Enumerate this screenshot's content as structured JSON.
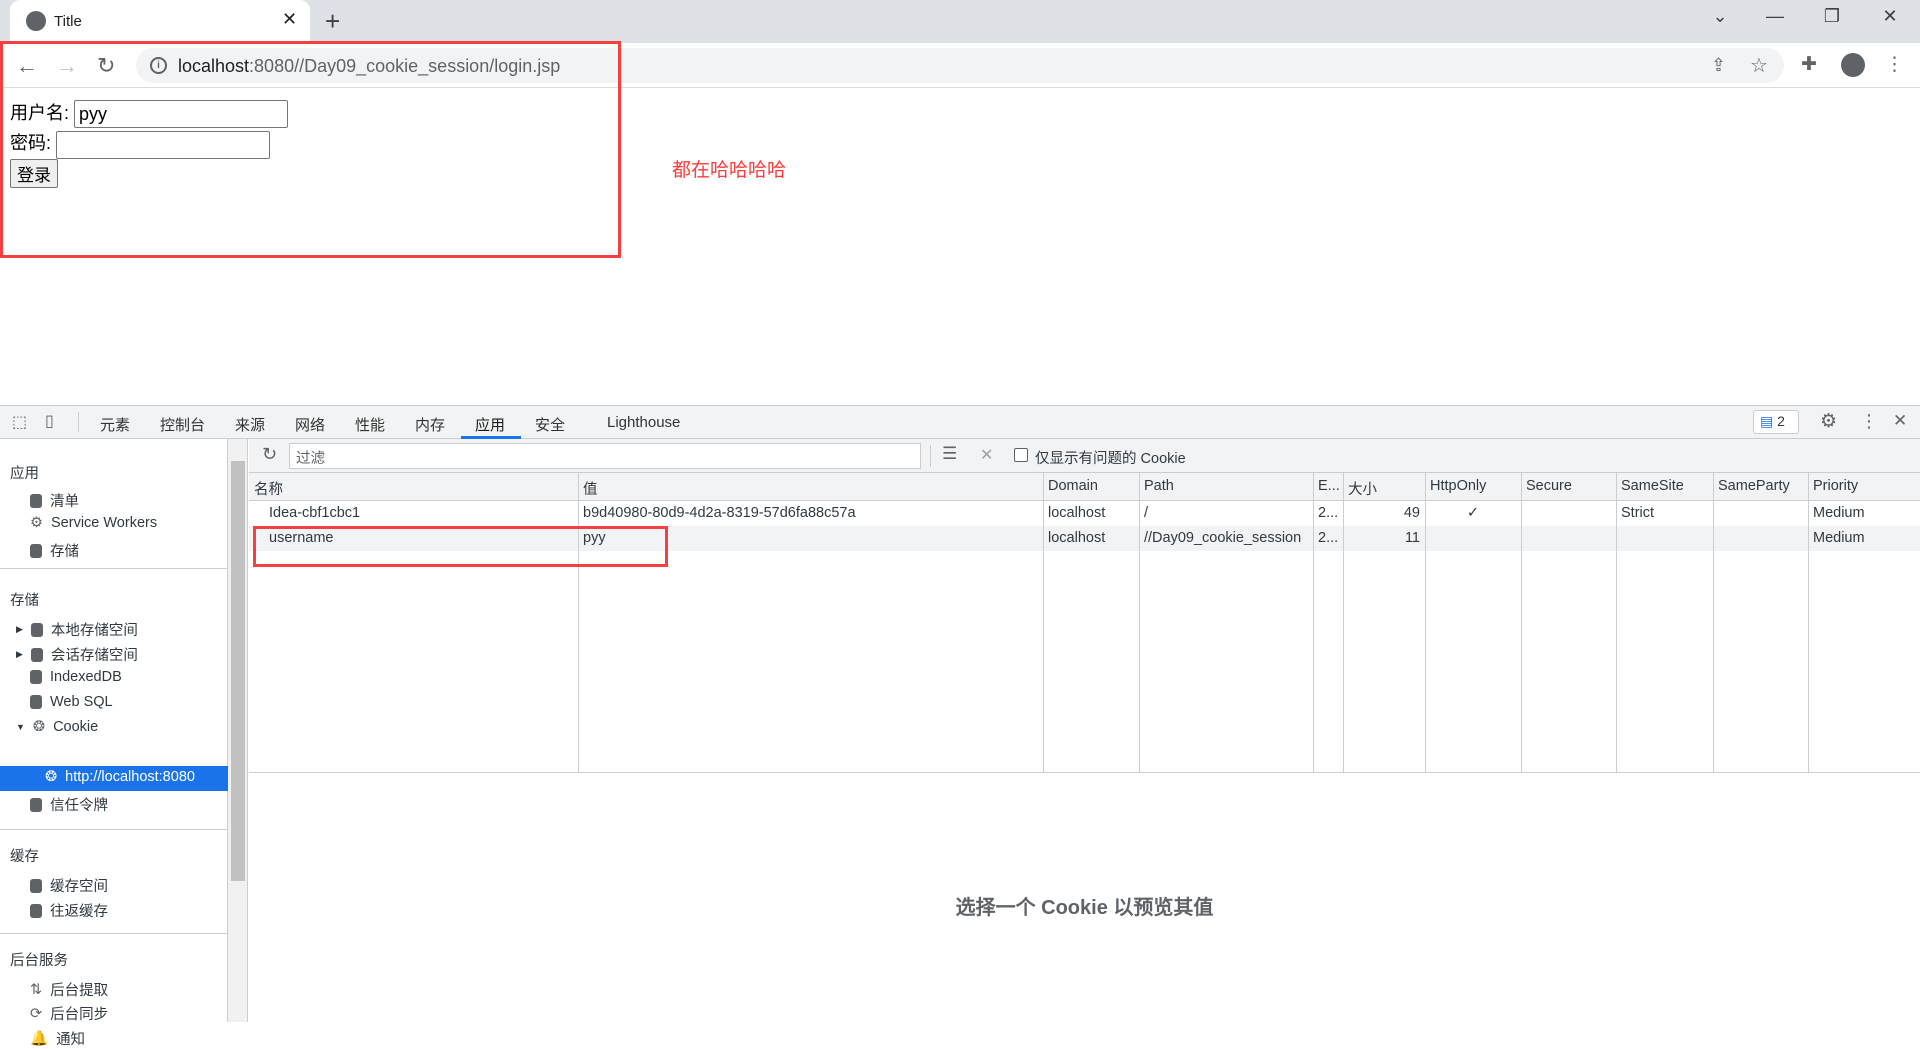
{
  "browser": {
    "tab_title": "Title",
    "url_host": "localhost",
    "url_rest": ":8080//Day09_cookie_session/login.jsp"
  },
  "page": {
    "username_label": "用户名:",
    "username_value": "pyy",
    "password_label": "密码:",
    "password_value": "",
    "login_button": "登录",
    "red_text": "都在哈哈哈哈"
  },
  "devtools": {
    "tabs": [
      "元素",
      "控制台",
      "来源",
      "网络",
      "性能",
      "内存",
      "应用",
      "安全",
      "Lighthouse"
    ],
    "active_tab": "应用",
    "issues_count": "2",
    "sidebar": {
      "sections": [
        {
          "title": "应用",
          "items": [
            "清单",
            "Service Workers",
            "存储"
          ]
        },
        {
          "title": "存储",
          "items": [
            "本地存储空间",
            "会话存储空间",
            "IndexedDB",
            "Web SQL",
            "Cookie",
            "http://localhost:8080",
            "信任令牌"
          ]
        },
        {
          "title": "缓存",
          "items": [
            "缓存空间",
            "往返缓存"
          ]
        },
        {
          "title": "后台服务",
          "items": [
            "后台提取",
            "后台同步",
            "通知"
          ]
        }
      ],
      "selected": "http://localhost:8080"
    },
    "filter": {
      "placeholder": "过滤",
      "only_issues_label": "仅显示有问题的 Cookie"
    },
    "table": {
      "columns": [
        "名称",
        "值",
        "Domain",
        "Path",
        "E...",
        "大小",
        "HttpOnly",
        "Secure",
        "SameSite",
        "SameParty",
        "Priority"
      ],
      "rows": [
        [
          "Idea-cbf1cbc1",
          "b9d40980-80d9-4d2a-8319-57d6fa88c57a",
          "localhost",
          "/",
          "2...",
          "49",
          "✓",
          "",
          "Strict",
          "",
          "Medium"
        ],
        [
          "username",
          "pyy",
          "localhost",
          "//Day09_cookie_session",
          "2...",
          "11",
          "",
          "",
          "",
          "",
          "Medium"
        ]
      ]
    },
    "preview_text": "选择一个 Cookie 以预览其值"
  },
  "colors": {
    "accent": "#1a73e8",
    "highlight_box": "#f44040",
    "red_text": "#ff3b3b"
  }
}
